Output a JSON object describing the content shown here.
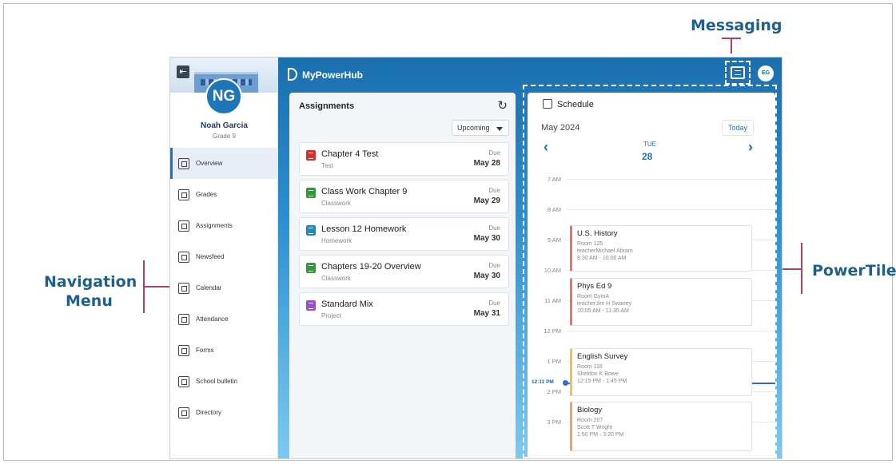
{
  "callouts": {
    "messaging": "Messaging",
    "navigation": [
      "Navigation",
      "Menu"
    ],
    "powertile": "PowerTile"
  },
  "sidebar": {
    "user_initials": "NG",
    "user_name": "Noah Garcia",
    "user_grade": "Grade 9",
    "items": [
      {
        "label": "Overview",
        "icon": "overview-icon"
      },
      {
        "label": "Grades",
        "icon": "grades-icon"
      },
      {
        "label": "Assignments",
        "icon": "assignments-icon"
      },
      {
        "label": "Newsfeed",
        "icon": "newsfeed-icon"
      },
      {
        "label": "Calendar",
        "icon": "calendar-icon"
      },
      {
        "label": "Attendance",
        "icon": "attendance-icon"
      },
      {
        "label": "Forms",
        "icon": "forms-icon"
      },
      {
        "label": "School bulletin",
        "icon": "megaphone-icon"
      },
      {
        "label": "Directory",
        "icon": "directory-icon"
      }
    ]
  },
  "header": {
    "brand": "MyPowerHub",
    "avatar_initials": "EG"
  },
  "assignments": {
    "title": "Assignments",
    "filter": "Upcoming",
    "items": [
      {
        "title": "Chapter 4 Test",
        "category": "Test",
        "due_label": "Due",
        "due_date": "May 28",
        "color": "#d32f2f"
      },
      {
        "title": "Class Work Chapter 9",
        "category": "Classwork",
        "due_label": "Due",
        "due_date": "May 29",
        "color": "#2e9b3a"
      },
      {
        "title": "Lesson 12 Homework",
        "category": "Homework",
        "due_label": "Due",
        "due_date": "May 30",
        "color": "#2787b8"
      },
      {
        "title": "Chapters 19-20 Overview",
        "category": "Classwork",
        "due_label": "Due",
        "due_date": "May 30",
        "color": "#2e9b3a"
      },
      {
        "title": "Standard Mix",
        "category": "Project",
        "due_label": "Due",
        "due_date": "May 31",
        "color": "#9c4fc9"
      }
    ]
  },
  "schedule": {
    "title": "Schedule",
    "month": "May 2024",
    "today_label": "Today",
    "day_of_week": "TUE",
    "day_number": "28",
    "hours": [
      "7 AM",
      "8 AM",
      "9 AM",
      "10 AM",
      "11 AM",
      "12 PM",
      "1 PM",
      "2 PM",
      "3 PM"
    ],
    "now_label": "12:11 PM",
    "events": [
      {
        "title": "U.S. History",
        "room": "Room 125",
        "teacher": "teacherMichael Abram",
        "time": "8:30 AM - 10:00 AM",
        "color": "#e57373"
      },
      {
        "title": "Phys Ed 9",
        "room": "Room GymA",
        "teacher": "teacherJim H Swaney",
        "time": "10:05 AM - 11:35 AM",
        "color": "#e57373"
      },
      {
        "title": "English Survey",
        "room": "Room 118",
        "teacher": "Sheldon K Bowe",
        "time": "12:15 PM - 1:45 PM",
        "color": "#f2c14e"
      },
      {
        "title": "Biology",
        "room": "Room 207",
        "teacher": "Scott T Wright",
        "time": "1:50 PM - 3:20 PM",
        "color": "#f2a65a"
      }
    ]
  }
}
